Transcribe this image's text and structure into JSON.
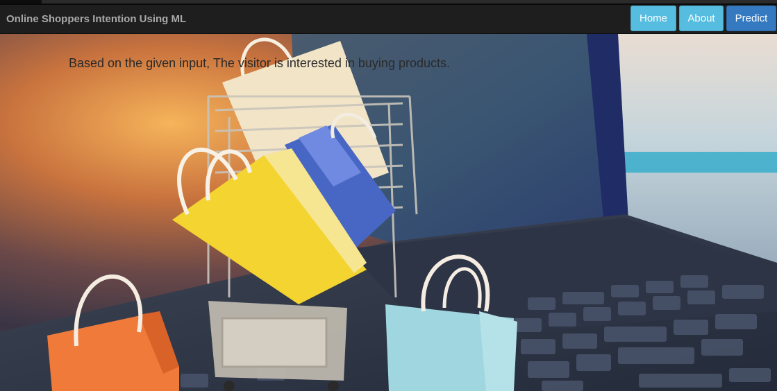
{
  "navbar": {
    "brand": "Online Shoppers Intention Using ML",
    "buttons": {
      "home": "Home",
      "about": "About",
      "predict": "Predict"
    }
  },
  "main": {
    "result_text": "Based on the given input, The visitor is interested in buying products."
  },
  "colors": {
    "navbar_bg": "#1e1e1e",
    "button_info": "#56bde0",
    "button_primary": "#3579c0"
  }
}
